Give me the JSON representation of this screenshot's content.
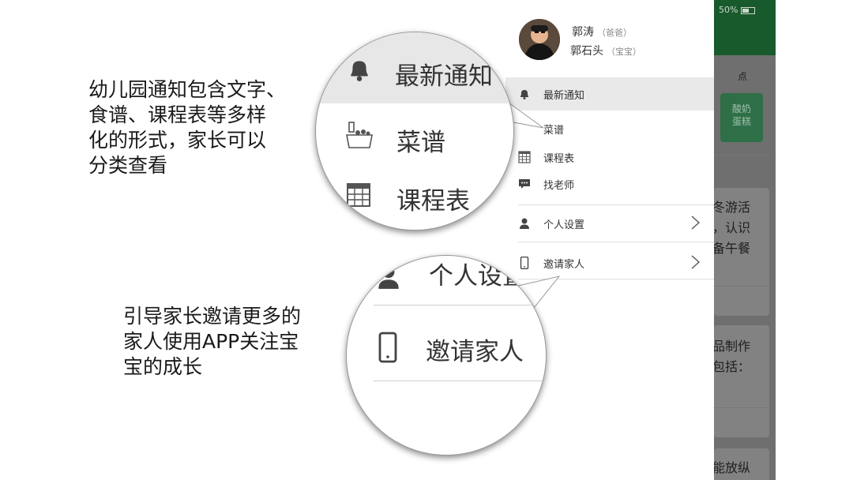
{
  "captions": {
    "left_top": "幼儿园通知包含文字、\n食谱、课程表等多样\n化的形式，家长可以\n分类查看",
    "left_bottom": "引导家长邀请更多的\n家人使用APP关注宝\n宝的成长"
  },
  "profile": {
    "parent_name": "郭涛",
    "parent_role": "（爸爸）",
    "child_name": "郭石头",
    "child_role": "（宝宝）"
  },
  "menu": {
    "notice": "最新通知",
    "recipe": "菜谱",
    "schedule": "课程表",
    "find_teacher": "找老师",
    "settings": "个人设置",
    "invite": "邀请家人"
  },
  "magnifier_top": {
    "notice": "最新通知",
    "recipe": "菜谱",
    "schedule": "课程表"
  },
  "magnifier_bottom": {
    "settings_partial": "个人设置",
    "invite": "邀请家人"
  },
  "background_app": {
    "status_battery": "50%",
    "header_partial": "点",
    "button_text": "酸奶\n蛋糕",
    "card1_lines": [
      "冬游活",
      "，认识",
      "备午餐"
    ],
    "card2_lines": [
      "品制作",
      "包括："
    ],
    "card3_lines": [
      "能放纵"
    ]
  },
  "icons": {
    "notice": "bell-icon",
    "recipe": "food-basket-icon",
    "schedule": "calendar-grid-icon",
    "find_teacher": "chat-bubble-icon",
    "settings": "person-icon",
    "invite": "phone-icon",
    "chevron": "chevron-right-icon"
  },
  "colors": {
    "header_green": "#185a2b",
    "button_green": "#2f6f48",
    "overlay_gray": "#6f6f6f",
    "menu_highlight": "#e9e9e9"
  }
}
